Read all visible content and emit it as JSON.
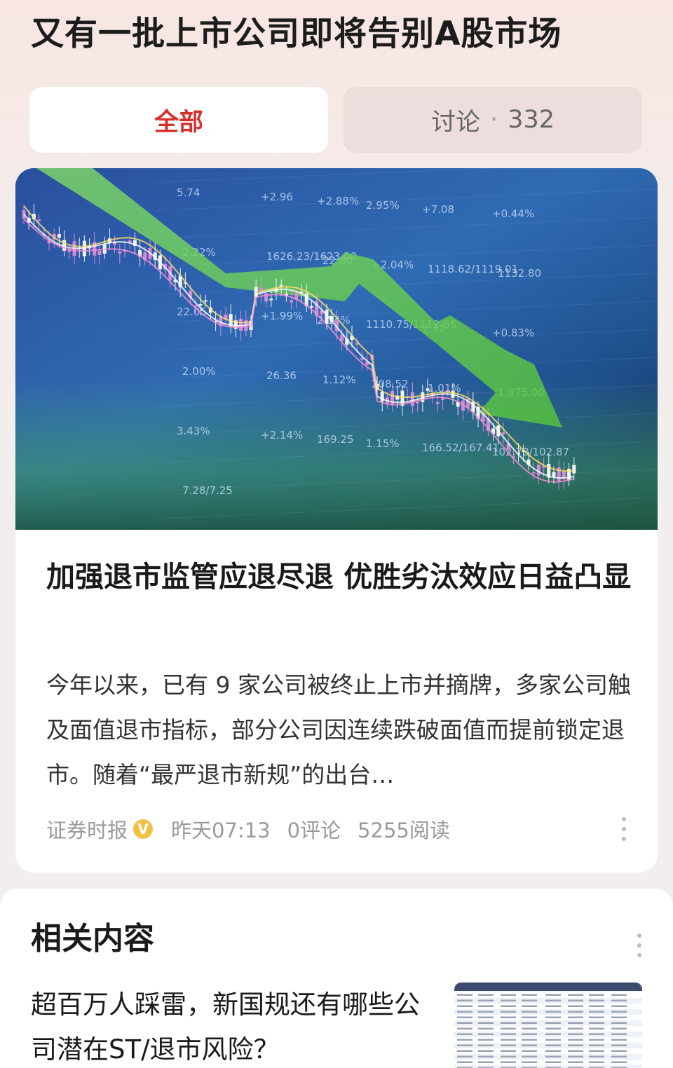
{
  "topic": {
    "title": "又有一批上市公司即将告别A股市场"
  },
  "tabs": {
    "all_label": "全部",
    "discuss_label": "讨论",
    "discuss_sep": "·",
    "discuss_count": "332"
  },
  "article": {
    "title": "加强退市监管应退尽退 优胜劣汰效应日益凸显",
    "summary": "今年以来，已有 9 家公司被终止上市并摘牌，多家公司触及面值退市指标，部分公司因连续跌破面值而提前锁定退市。随着“最严退市新规”的出台…",
    "source": "证券时报",
    "verified_badge": "V",
    "time": "昨天07:13",
    "comments": "0评论",
    "reads": "5255阅读",
    "hero_ticker_text": [
      "5.74",
      "+2.96",
      "+2.88%",
      "2.95%",
      "+7.08",
      "+0.44%",
      "2.22%",
      "1626.23/1623.00",
      "22.80",
      "+2.04%",
      "1118.62/1119.01",
      "1132.80",
      "22.05",
      "+1.99%",
      "2.14%",
      "1110.75/1112.66",
      "7.32",
      "+0.83%",
      "2.00%",
      "26.36",
      "1.12%",
      "208.52",
      "1.01%",
      "1,875.00",
      "3.43%",
      "+2.14%",
      "169.25",
      "1.15%",
      "166.52/167.41",
      "102.78/102.87",
      "7.28/7.25"
    ]
  },
  "related": {
    "heading": "相关内容",
    "items": [
      {
        "title": "超百万人踩雷，新国规还有哪些公司潜在ST/退市风险？"
      }
    ]
  },
  "colors": {
    "accent_red": "#d6302b",
    "badge_gold": "#f2c044",
    "muted_text": "#9a9a9a"
  },
  "icons": [
    "verified-badge-icon",
    "more-vertical-icon"
  ]
}
